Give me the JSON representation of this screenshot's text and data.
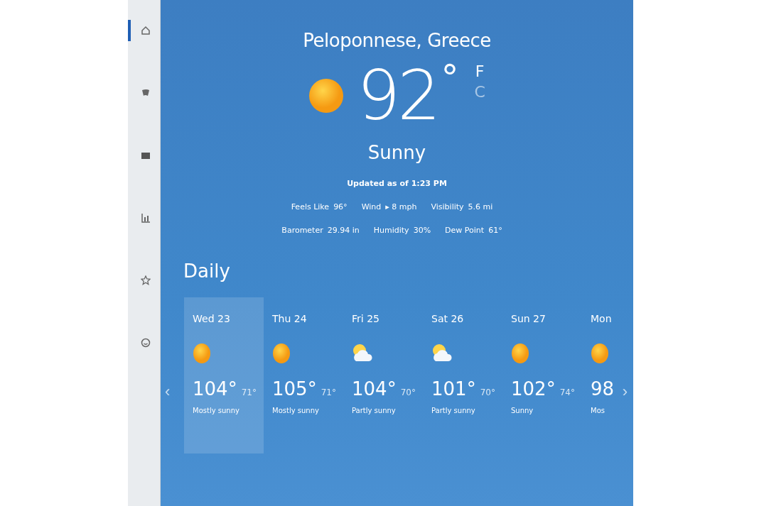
{
  "sidebar": {
    "items": [
      {
        "kind": "home",
        "selected": true
      },
      {
        "kind": "news",
        "selected": false
      },
      {
        "kind": "map",
        "selected": false
      },
      {
        "kind": "chart",
        "selected": false
      },
      {
        "kind": "star",
        "selected": false
      },
      {
        "kind": "smile",
        "selected": false
      }
    ]
  },
  "current": {
    "location": "Peloponnese, Greece",
    "temperature": "92",
    "degree": "°",
    "units": [
      {
        "label": "F",
        "selected": true
      },
      {
        "label": "C",
        "selected": false
      }
    ],
    "condition": "Sunny",
    "updated": "Updated as of 1:23 PM",
    "details": [
      [
        {
          "label": "Feels Like",
          "value": "96°"
        },
        {
          "label": "Wind",
          "value": "▸ 8 mph"
        },
        {
          "label": "Visibility",
          "value": "5.6 mi"
        }
      ],
      [
        {
          "label": "Barometer",
          "value": "29.94 in"
        },
        {
          "label": "Humidity",
          "value": "30%"
        },
        {
          "label": "Dew Point",
          "value": "61°"
        }
      ]
    ]
  },
  "daily": {
    "title": "Daily",
    "prev": "‹",
    "next": "›",
    "days": [
      {
        "day": "Wed 23",
        "kind": "sun",
        "high": "104°",
        "low": "71°",
        "description": "Mostly sunny",
        "selected": true
      },
      {
        "day": "Thu 24",
        "kind": "sun",
        "high": "105°",
        "low": "71°",
        "description": "Mostly sunny",
        "selected": false
      },
      {
        "day": "Fri 25",
        "kind": "partly",
        "high": "104°",
        "low": "70°",
        "description": "Partly sunny",
        "selected": false
      },
      {
        "day": "Sat 26",
        "kind": "partly",
        "high": "101°",
        "low": "70°",
        "description": "Partly sunny",
        "selected": false
      },
      {
        "day": "Sun 27",
        "kind": "sun",
        "high": "102°",
        "low": "74°",
        "description": "Sunny",
        "selected": false
      },
      {
        "day": "Mon",
        "kind": "sun",
        "high": "98",
        "description": "Mos",
        "selected": false
      }
    ]
  }
}
